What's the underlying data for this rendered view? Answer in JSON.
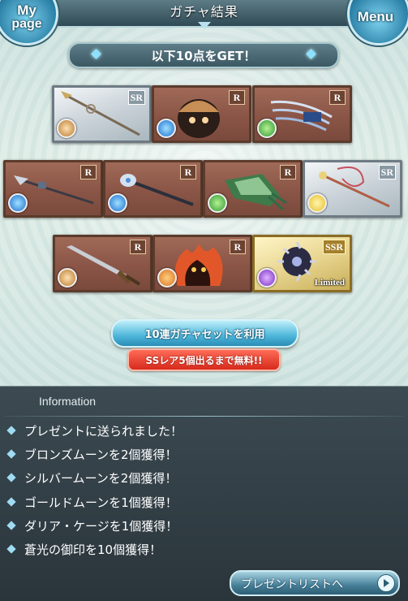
{
  "header": {
    "title": "ガチャ結果",
    "mypage_label_line1": "My",
    "mypage_label_line2": "page",
    "menu_label": "Menu"
  },
  "result_banner": "以下10点をGET！",
  "results": [
    {
      "rarity": "SR",
      "element": "earth",
      "art": "spear"
    },
    {
      "rarity": "R",
      "element": "water",
      "art": "helmet-creature"
    },
    {
      "rarity": "R",
      "element": "wind",
      "art": "claw"
    },
    {
      "rarity": "R",
      "element": "water",
      "art": "lance"
    },
    {
      "rarity": "R",
      "element": "water",
      "art": "staff"
    },
    {
      "rarity": "R",
      "element": "wind",
      "art": "gauntlet"
    },
    {
      "rarity": "SR",
      "element": "light",
      "art": "ribbon-staff"
    },
    {
      "rarity": "R",
      "element": "earth",
      "art": "sword"
    },
    {
      "rarity": "R",
      "element": "fire",
      "art": "flame-spirit"
    },
    {
      "rarity": "SSR",
      "element": "dark",
      "art": "cage",
      "tag": "Limited"
    }
  ],
  "gacha_button": "10連ガチャセットを利用",
  "free_banner": "SSレア5個出るまで無料!!",
  "information": {
    "heading": "Information",
    "items": [
      "プレゼントに送られました！",
      "ブロンズムーンを2個獲得！",
      "シルバームーンを2個獲得！",
      "ゴールドムーンを1個獲得！",
      "ダリア・ケージを1個獲得！",
      "蒼光の御印を10個獲得！"
    ]
  },
  "present_button": "プレゼントリストへ"
}
